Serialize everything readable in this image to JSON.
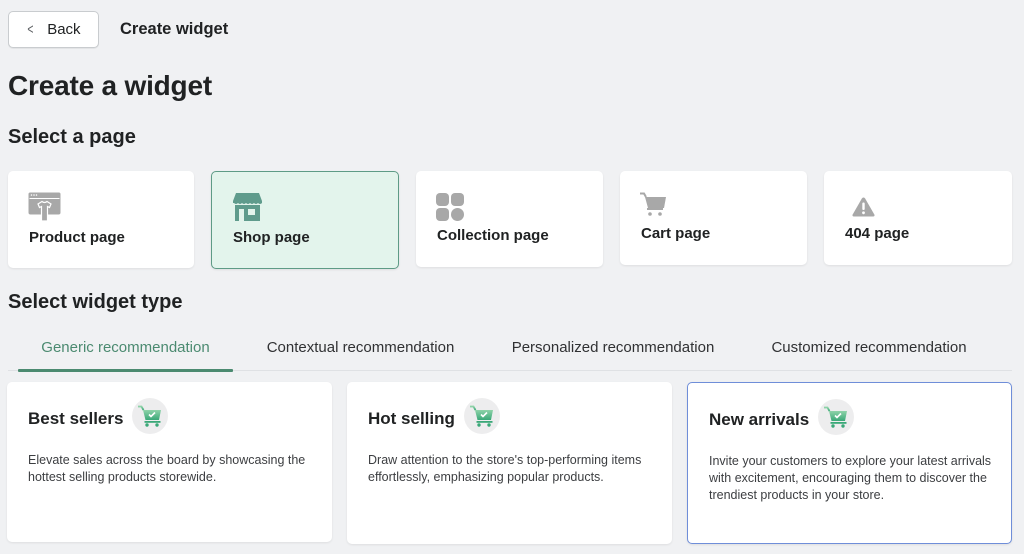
{
  "header": {
    "back_label": "Back",
    "breadcrumb_title": "Create widget"
  },
  "page_title": "Create a widget",
  "select_page": {
    "title": "Select a page",
    "items": [
      {
        "label": "Product page",
        "icon": "product-page-icon",
        "selected": false
      },
      {
        "label": "Shop page",
        "icon": "shop-icon",
        "selected": true
      },
      {
        "label": "Collection page",
        "icon": "collection-grid-icon",
        "selected": false
      },
      {
        "label": "Cart page",
        "icon": "cart-icon",
        "selected": false
      },
      {
        "label": "404 page",
        "icon": "warning-icon",
        "selected": false
      }
    ]
  },
  "select_widget": {
    "title": "Select widget type",
    "tabs": [
      {
        "label": "Generic recommendation",
        "active": true
      },
      {
        "label": "Contextual recommendation",
        "active": false
      },
      {
        "label": "Personalized recommendation",
        "active": false
      },
      {
        "label": "Customized recommendation",
        "active": false
      }
    ],
    "cards": [
      {
        "title": "Best sellers",
        "icon": "cart-check-icon",
        "description": "Elevate sales across the board by showcasing the hottest selling products storewide.",
        "selected": false
      },
      {
        "title": "Hot selling",
        "icon": "cart-check-icon",
        "description": "Draw attention to the store's top-performing items effortlessly, emphasizing popular products.",
        "selected": false
      },
      {
        "title": "New arrivals",
        "icon": "cart-check-icon",
        "description": "Invite your customers to explore your latest arrivals with excitement, encouraging them to discover the trendiest products in your store.",
        "selected": true
      }
    ]
  },
  "colors": {
    "accent_green": "#4b8a70",
    "selected_page_bg": "#e3f4ec",
    "selected_widget_border": "#6f8ed9",
    "icon_gray": "#a8a8a8"
  }
}
